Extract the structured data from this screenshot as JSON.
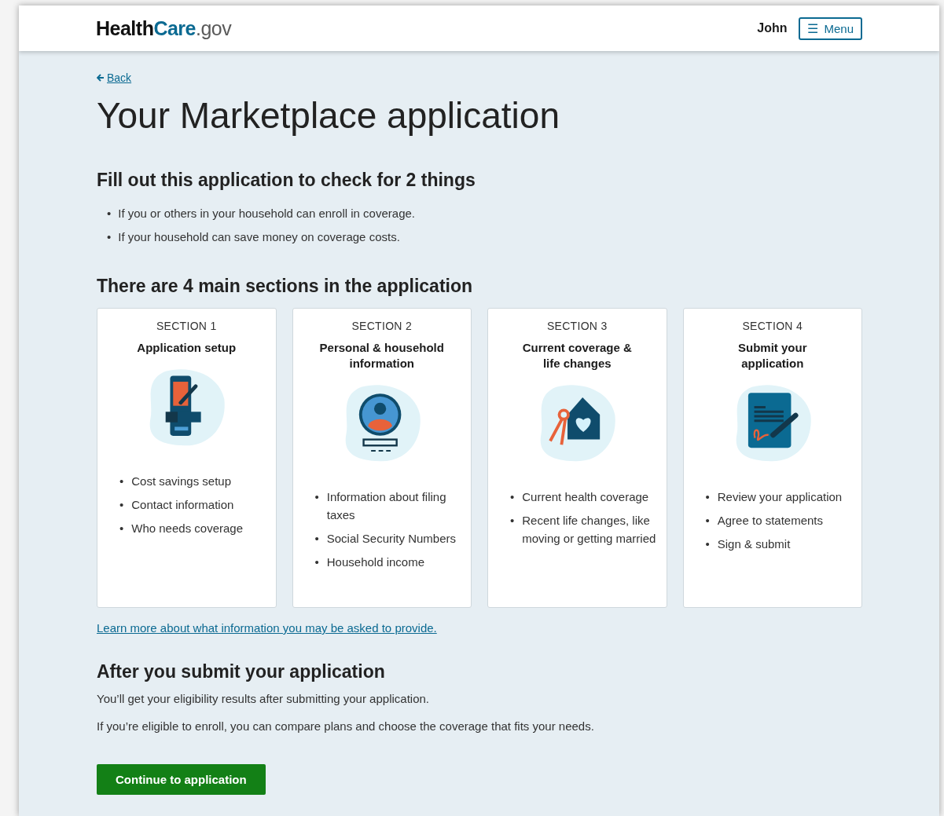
{
  "header": {
    "logo": [
      {
        "text": "Health",
        "kind": "dark"
      },
      {
        "text": "Care",
        "kind": "brand"
      },
      {
        "text": ".gov",
        "kind": "light"
      }
    ],
    "user": "John",
    "menu_button": {
      "icon": "☰",
      "label": "Menu"
    }
  },
  "back_link": "Back",
  "title": "Your Marketplace application",
  "bullet": "•",
  "intro": {
    "heading": "Fill out this application to check for 2 things",
    "items": [
      "If you or others in your household can enroll in coverage.",
      "If your household can save money on coverage costs."
    ]
  },
  "sections": {
    "heading": "There are 4 main sections in the application",
    "cards": [
      {
        "label": "SECTION 1",
        "title": "Application setup",
        "items": [
          "Cost savings setup",
          "Contact information",
          "Who needs coverage"
        ]
      },
      {
        "label": "SECTION 2",
        "title": "Personal & household information",
        "items": [
          "Information about filing taxes",
          "Social Security Numbers",
          "Household income"
        ]
      },
      {
        "label": "SECTION 3",
        "title": "Current coverage & life changes",
        "items": [
          "Current health coverage",
          "Recent life changes, like moving or getting married"
        ]
      },
      {
        "label": "SECTION 4",
        "title": "Submit your application",
        "items": [
          "Review your application",
          "Agree to statements",
          "Sign & submit"
        ]
      }
    ]
  },
  "learn_more_link": "Learn more about what information you may be asked to provide.",
  "after": {
    "heading": "After you submit your application",
    "paragraphs": [
      "You’ll get your eligibility results after submitting your application.",
      "If you’re eligible to enroll, you can compare plans and choose the coverage that fits your needs."
    ]
  },
  "continue_button": "Continue to application"
}
